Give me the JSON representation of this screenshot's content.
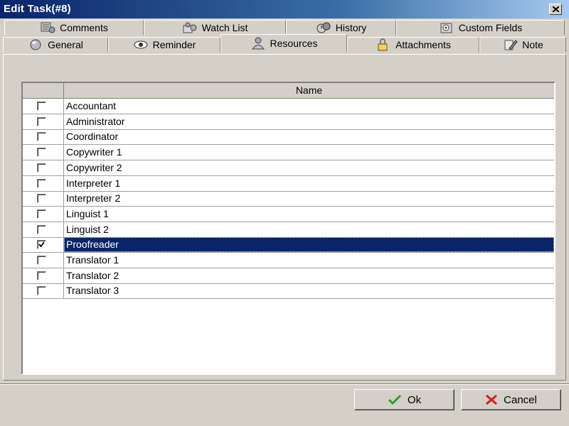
{
  "window": {
    "title": "Edit Task(#8)"
  },
  "tabs_row1": [
    {
      "label": "Comments",
      "icon": "comments-icon"
    },
    {
      "label": "Watch List",
      "icon": "watch-list-icon"
    },
    {
      "label": "History",
      "icon": "history-icon"
    },
    {
      "label": "Custom Fields",
      "icon": "custom-fields-icon"
    }
  ],
  "tabs_row2": [
    {
      "label": "General",
      "icon": "general-icon"
    },
    {
      "label": "Reminder",
      "icon": "reminder-icon"
    },
    {
      "label": "Resources",
      "icon": "resources-icon",
      "selected": true
    },
    {
      "label": "Attachments",
      "icon": "attachments-icon"
    },
    {
      "label": "Note",
      "icon": "note-icon"
    }
  ],
  "grid": {
    "column_name": "Name",
    "rows": [
      {
        "name": "Accountant",
        "checked": false
      },
      {
        "name": "Administrator",
        "checked": false
      },
      {
        "name": "Coordinator",
        "checked": false
      },
      {
        "name": "Copywriter 1",
        "checked": false
      },
      {
        "name": "Copywriter 2",
        "checked": false
      },
      {
        "name": "Interpreter 1",
        "checked": false
      },
      {
        "name": "Interpreter 2",
        "checked": false
      },
      {
        "name": "Linguist 1",
        "checked": false
      },
      {
        "name": "Linguist 2",
        "checked": false
      },
      {
        "name": "Proofreader",
        "checked": true,
        "selected": true
      },
      {
        "name": "Translator 1",
        "checked": false
      },
      {
        "name": "Translator 2",
        "checked": false
      },
      {
        "name": "Translator 3",
        "checked": false
      }
    ]
  },
  "buttons": {
    "ok": "Ok",
    "cancel": "Cancel"
  },
  "colors": {
    "selection": "#0a246a",
    "ok_check": "#2e9b2e",
    "cancel_x": "#d02020"
  }
}
